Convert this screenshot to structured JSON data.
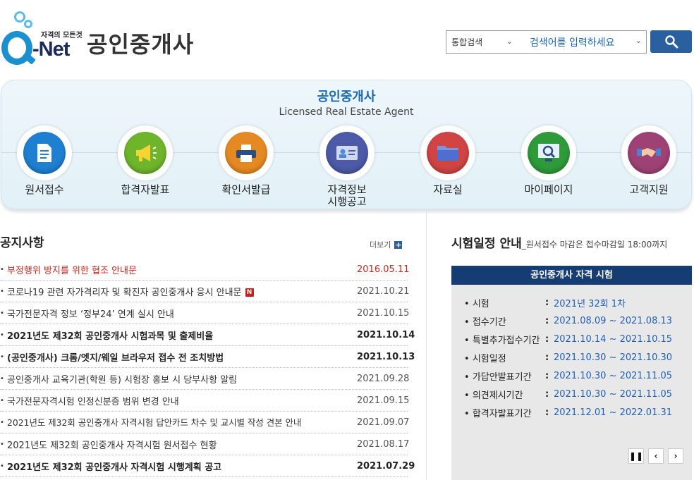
{
  "logo": {
    "tagline": "자격의 모든것",
    "brand": "-Net"
  },
  "site_title": "공인중개사",
  "search": {
    "scope": "통합검색",
    "placeholder": "검색어를 입력하세요"
  },
  "hero": {
    "title": "공인중개사",
    "subtitle": "Licensed Real Estate Agent"
  },
  "menu": [
    {
      "label": "원서접수",
      "icon": "document-icon",
      "color": "#1f7fd1"
    },
    {
      "label": "합격자발표",
      "icon": "megaphone-icon",
      "color": "#6fb52c"
    },
    {
      "label": "확인서발급",
      "icon": "printer-icon",
      "color": "#e58a22"
    },
    {
      "label": "자격정보\n시행공고",
      "icon": "id-card-icon",
      "color": "#4d5aa8"
    },
    {
      "label": "자료실",
      "icon": "folder-icon",
      "color": "#d04444"
    },
    {
      "label": "마이페이지",
      "icon": "monitor-icon",
      "color": "#2e9a3a"
    },
    {
      "label": "고객지원",
      "icon": "handshake-icon",
      "color": "#9e4276"
    }
  ],
  "notices": {
    "title": "공지사항",
    "more": "더보기",
    "items": [
      {
        "text": "부정행위 방지를 위한 협조 안내문",
        "date": "2016.05.11",
        "style": "red"
      },
      {
        "text": "코로나19 관련 자가격리자 및 확진자 공인중개사 응시 안내문",
        "date": "2021.10.21",
        "style": "normal",
        "badge": "N"
      },
      {
        "text": "국가전문자격 정보 ‘정부24’ 연계 실시 안내",
        "date": "2021.10.15",
        "style": "normal"
      },
      {
        "text": "2021년도 제32회 공인중개사 시험과목 및 출제비율",
        "date": "2021.10.14",
        "style": "bold"
      },
      {
        "text": "(공인중개사) 크롬/엣지/웨일 브라우저 접수 전 조치방법",
        "date": "2021.10.13",
        "style": "bold"
      },
      {
        "text": "공인중개사 교육기관(학원 등) 시험장 홍보 시 당부사항 알림",
        "date": "2021.09.28",
        "style": "normal"
      },
      {
        "text": "국가전문자격시험 인정신분증 범위 변경 안내",
        "date": "2021.09.15",
        "style": "normal"
      },
      {
        "text": "2021년도 제32회 공인중개사 자격시험 답안카드 차수 및 교시별 작성 견본 안내",
        "date": "2021.09.07",
        "style": "normal"
      },
      {
        "text": "2021년도 제32회 공인중개사 자격시험 원서접수 현황",
        "date": "2021.08.17",
        "style": "normal"
      },
      {
        "text": "2021년도 제32회 공인중개사 자격시험 시행계획 공고",
        "date": "2021.07.29",
        "style": "bold"
      }
    ]
  },
  "schedule": {
    "title": "시험일정 안내",
    "note": "_원서접수 마감은 접수마감일 18:00까지",
    "box_title": "공인중개사 자격 시험",
    "rows": [
      {
        "key": "시험",
        "value": "2021년 32회 1차"
      },
      {
        "key": "접수기간",
        "value": "2021.08.09 ~ 2021.08.13"
      },
      {
        "key": "특별추가접수기간",
        "value": "2021.10.14 ~ 2021.10.15"
      },
      {
        "key": "시험일정",
        "value": "2021.10.30 ~ 2021.10.30"
      },
      {
        "key": "가답안발표기간",
        "value": "2021.10.30 ~ 2021.11.05"
      },
      {
        "key": "의견제시기간",
        "value": "2021.10.30 ~ 2021.11.05"
      },
      {
        "key": "합격자발표기간",
        "value": "2021.12.01 ~ 2022.01.31"
      }
    ],
    "colon": ":",
    "bullet": "•"
  }
}
